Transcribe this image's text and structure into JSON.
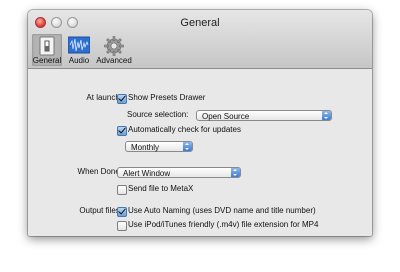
{
  "window": {
    "title": "General"
  },
  "toolbar": {
    "items": [
      {
        "label": "General",
        "icon": "switch-icon",
        "selected": true
      },
      {
        "label": "Audio",
        "icon": "waveform-icon",
        "selected": false
      },
      {
        "label": "Advanced",
        "icon": "gear-icon",
        "selected": false
      }
    ]
  },
  "launch": {
    "label": "At launch:",
    "show_presets": {
      "text": "Show Presets Drawer",
      "checked": true
    },
    "source_selection": {
      "label": "Source selection:",
      "value": "Open Source"
    },
    "auto_check": {
      "text": "Automatically check for updates",
      "checked": true
    },
    "frequency": {
      "value": "Monthly"
    }
  },
  "done": {
    "label": "When Done:",
    "action": {
      "value": "Alert Window"
    },
    "send_metax": {
      "text": "Send file to MetaX",
      "checked": false
    }
  },
  "output": {
    "label": "Output files:",
    "auto_naming": {
      "text": "Use Auto Naming (uses DVD name and title number)",
      "checked": true
    },
    "itunes_ext": {
      "text": "Use iPod/iTunes friendly (.m4v) file extension for MP4",
      "checked": false
    }
  },
  "colors": {
    "accent": "#3d7cd1",
    "window_bg": "#e8e8e8"
  }
}
